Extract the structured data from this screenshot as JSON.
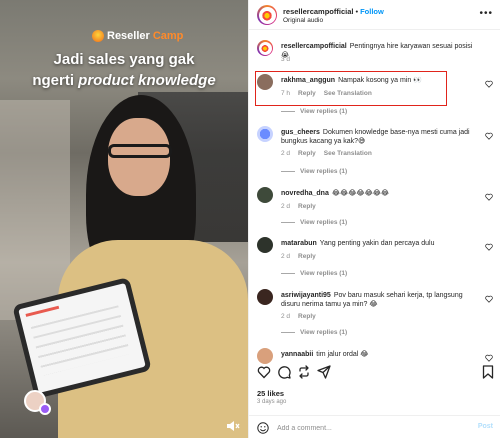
{
  "video": {
    "brand": {
      "name": "Reseller",
      "tag": "Camp"
    },
    "caption_line1": "Jadi sales yang gak",
    "caption_line2_pre": "ngerti ",
    "caption_line2_em": "product knowledge"
  },
  "header": {
    "username": "resellercampofficial",
    "dot": "•",
    "follow": "Follow",
    "subtitle": "Original audio",
    "more": "•••"
  },
  "caption_post": {
    "username": "resellercampofficial",
    "text": "Pentingnya hire karyawan sesuai posisi 😭",
    "time": "3 d"
  },
  "comments": [
    {
      "user": "rakhma_anggun",
      "text": "Nampak kosong ya min 👀",
      "time": "7 h",
      "reply": "Reply",
      "translation": "See Translation",
      "replies": "View replies (1)"
    },
    {
      "user": "gus_cheers",
      "text": "Dokumen knowledge base-nya mesti cuma jadi bungkus kacang ya kak?😅",
      "time": "2 d",
      "reply": "Reply",
      "translation": "See Translation",
      "replies": "View replies (1)"
    },
    {
      "user": "novredha_dna",
      "text": "😂😂😂😂😂😂😂",
      "time": "2 d",
      "reply": "Reply",
      "replies": "View replies (1)"
    },
    {
      "user": "matarabun",
      "text": "Yang penting yakin dan percaya dulu",
      "time": "2 d",
      "reply": "Reply",
      "replies": "View replies (1)"
    },
    {
      "user": "asriwijayanti95",
      "text": "Pov baru masuk sehari kerja, tp langsung disuru nerima tamu ya min? 😂",
      "time": "2 d",
      "reply": "Reply",
      "replies": "View replies (1)"
    },
    {
      "user": "yannaabii",
      "text": "tim jalur ordal 😂"
    }
  ],
  "footer": {
    "likes": "25 likes",
    "date": "3 days ago",
    "add_comment_placeholder": "Add a comment...",
    "post": "Post"
  },
  "colors": {
    "follow": "#0095f6",
    "highlight": "#e0241b",
    "muted": "#8e8e8e"
  },
  "icons": [
    "heart-icon",
    "comment-icon",
    "share-icon",
    "repost-icon",
    "bookmark-icon",
    "emoji-icon",
    "mute-icon",
    "more-icon"
  ]
}
